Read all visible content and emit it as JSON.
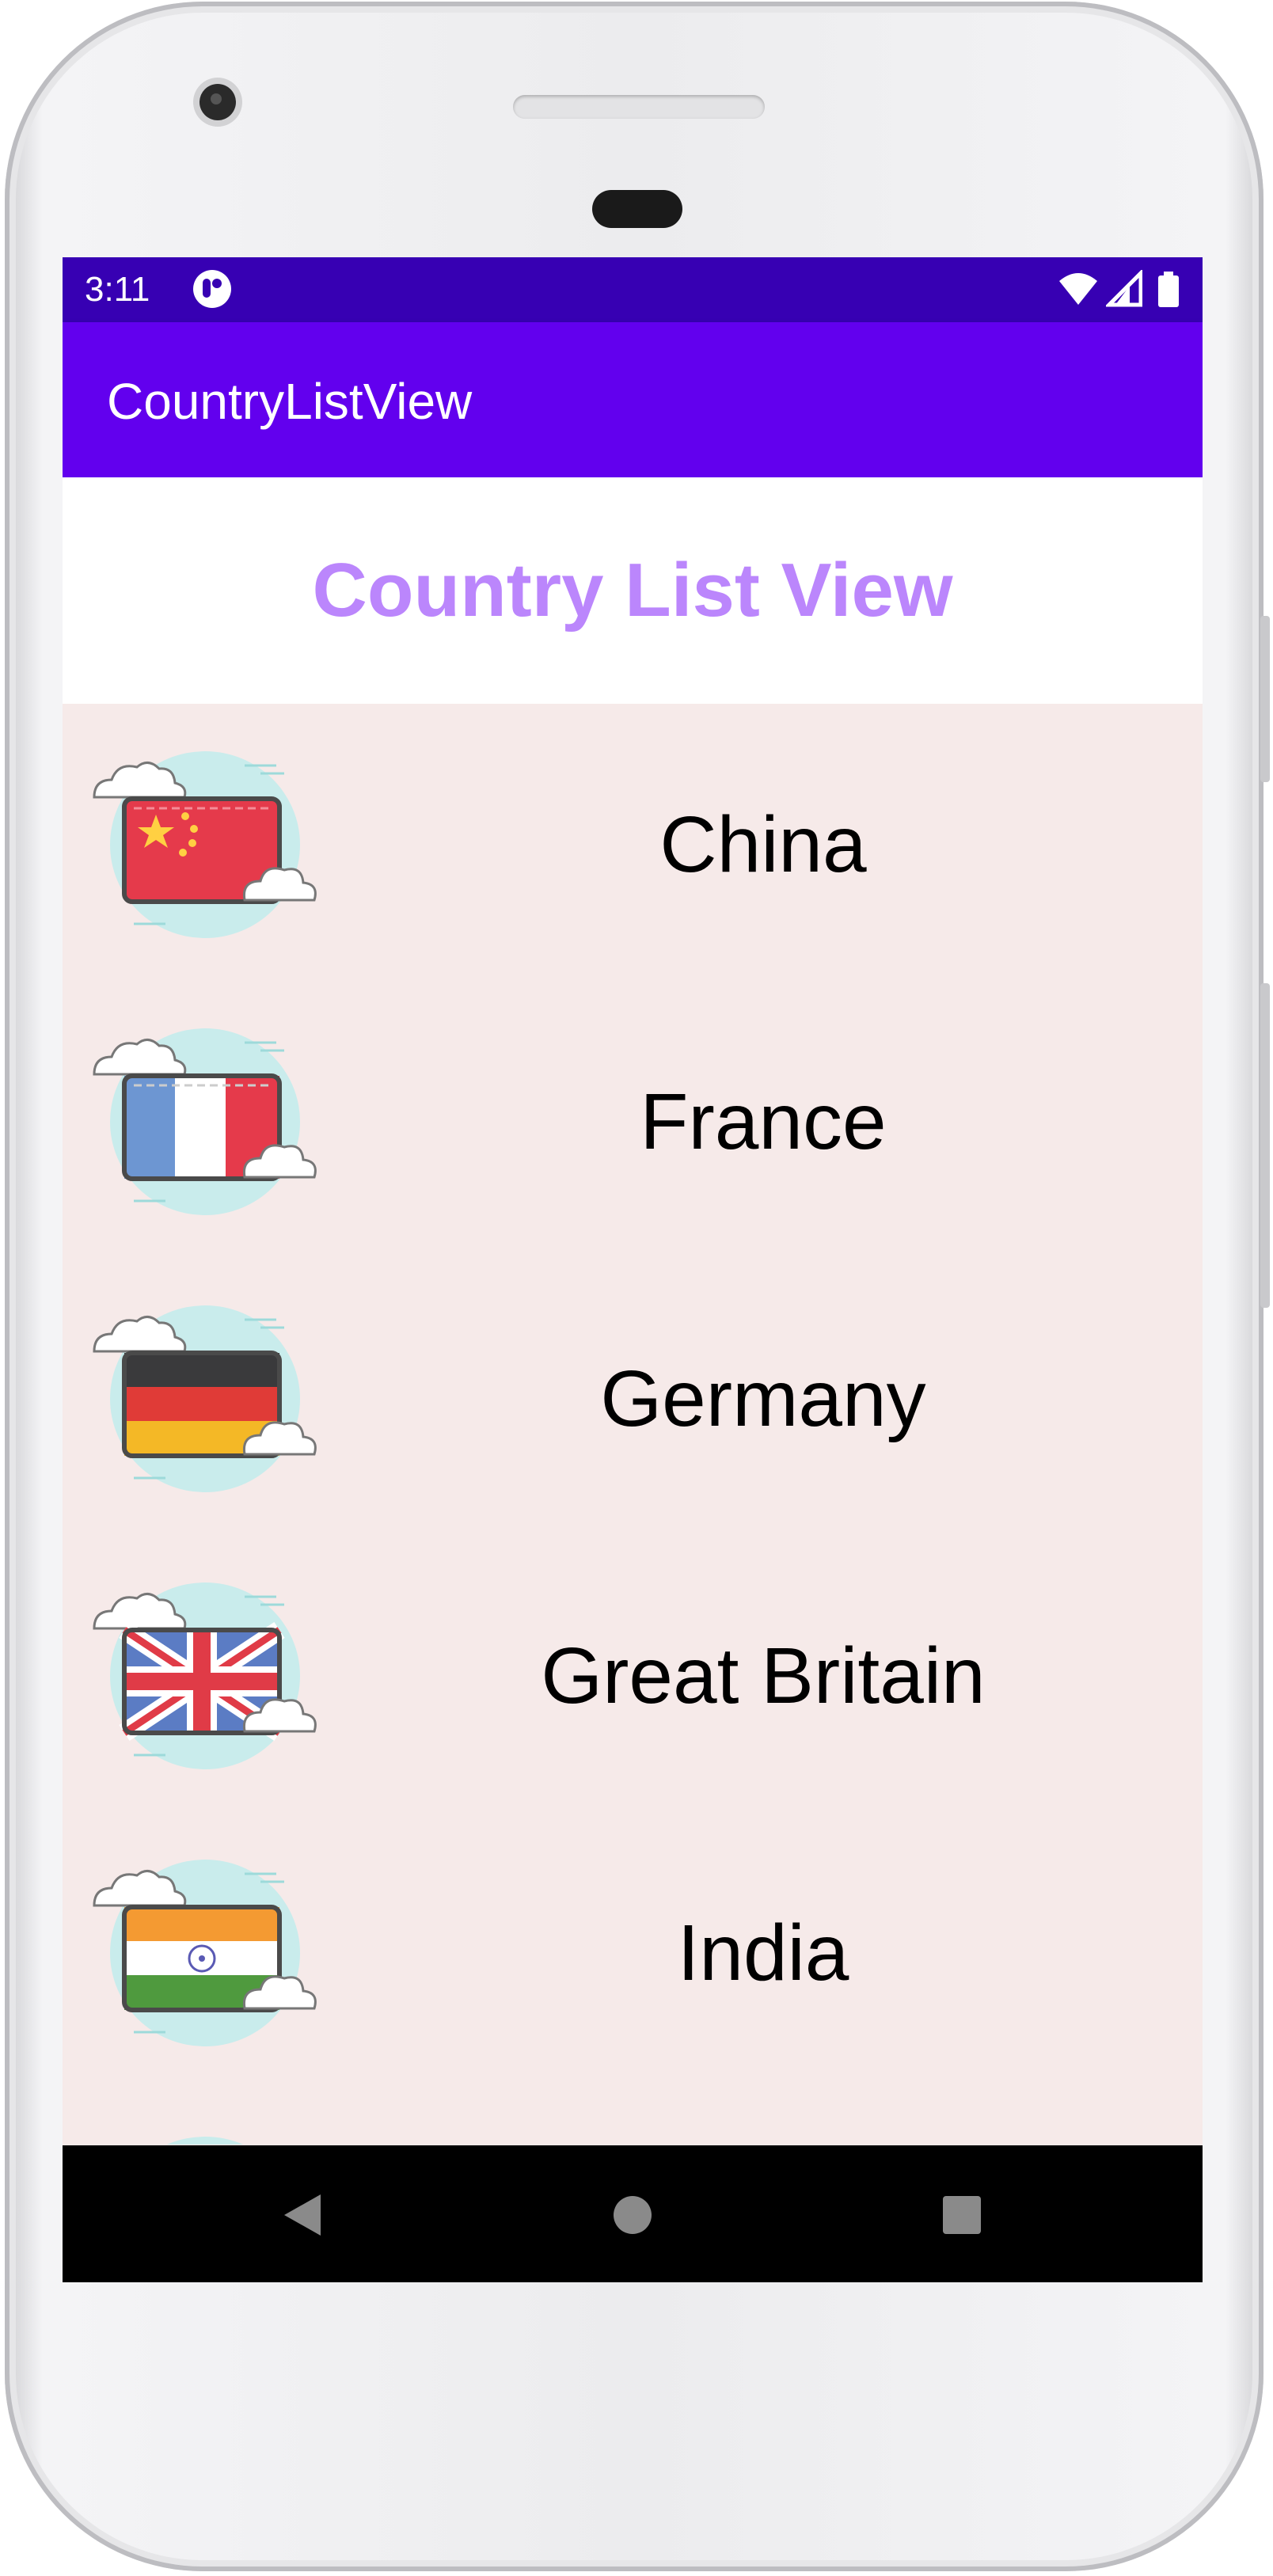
{
  "status_bar": {
    "time": "3:11",
    "icons": [
      "app-notification-icon",
      "wifi-icon",
      "signal-icon",
      "battery-icon"
    ]
  },
  "app_bar": {
    "title": "CountryListView"
  },
  "header": {
    "title": "Country List View"
  },
  "countries": [
    {
      "name": "China",
      "flag_icon": "china-flag-icon"
    },
    {
      "name": "France",
      "flag_icon": "france-flag-icon"
    },
    {
      "name": "Germany",
      "flag_icon": "germany-flag-icon"
    },
    {
      "name": "Great Britain",
      "flag_icon": "great-britain-flag-icon"
    },
    {
      "name": "India",
      "flag_icon": "india-flag-icon"
    }
  ],
  "nav_bar": {
    "buttons": [
      "back-icon",
      "home-icon",
      "recents-icon"
    ]
  },
  "colors": {
    "status_bar": "#3700b3",
    "app_bar": "#6200ee",
    "header_text": "#bb86fc",
    "list_background": "#f6eae9"
  }
}
